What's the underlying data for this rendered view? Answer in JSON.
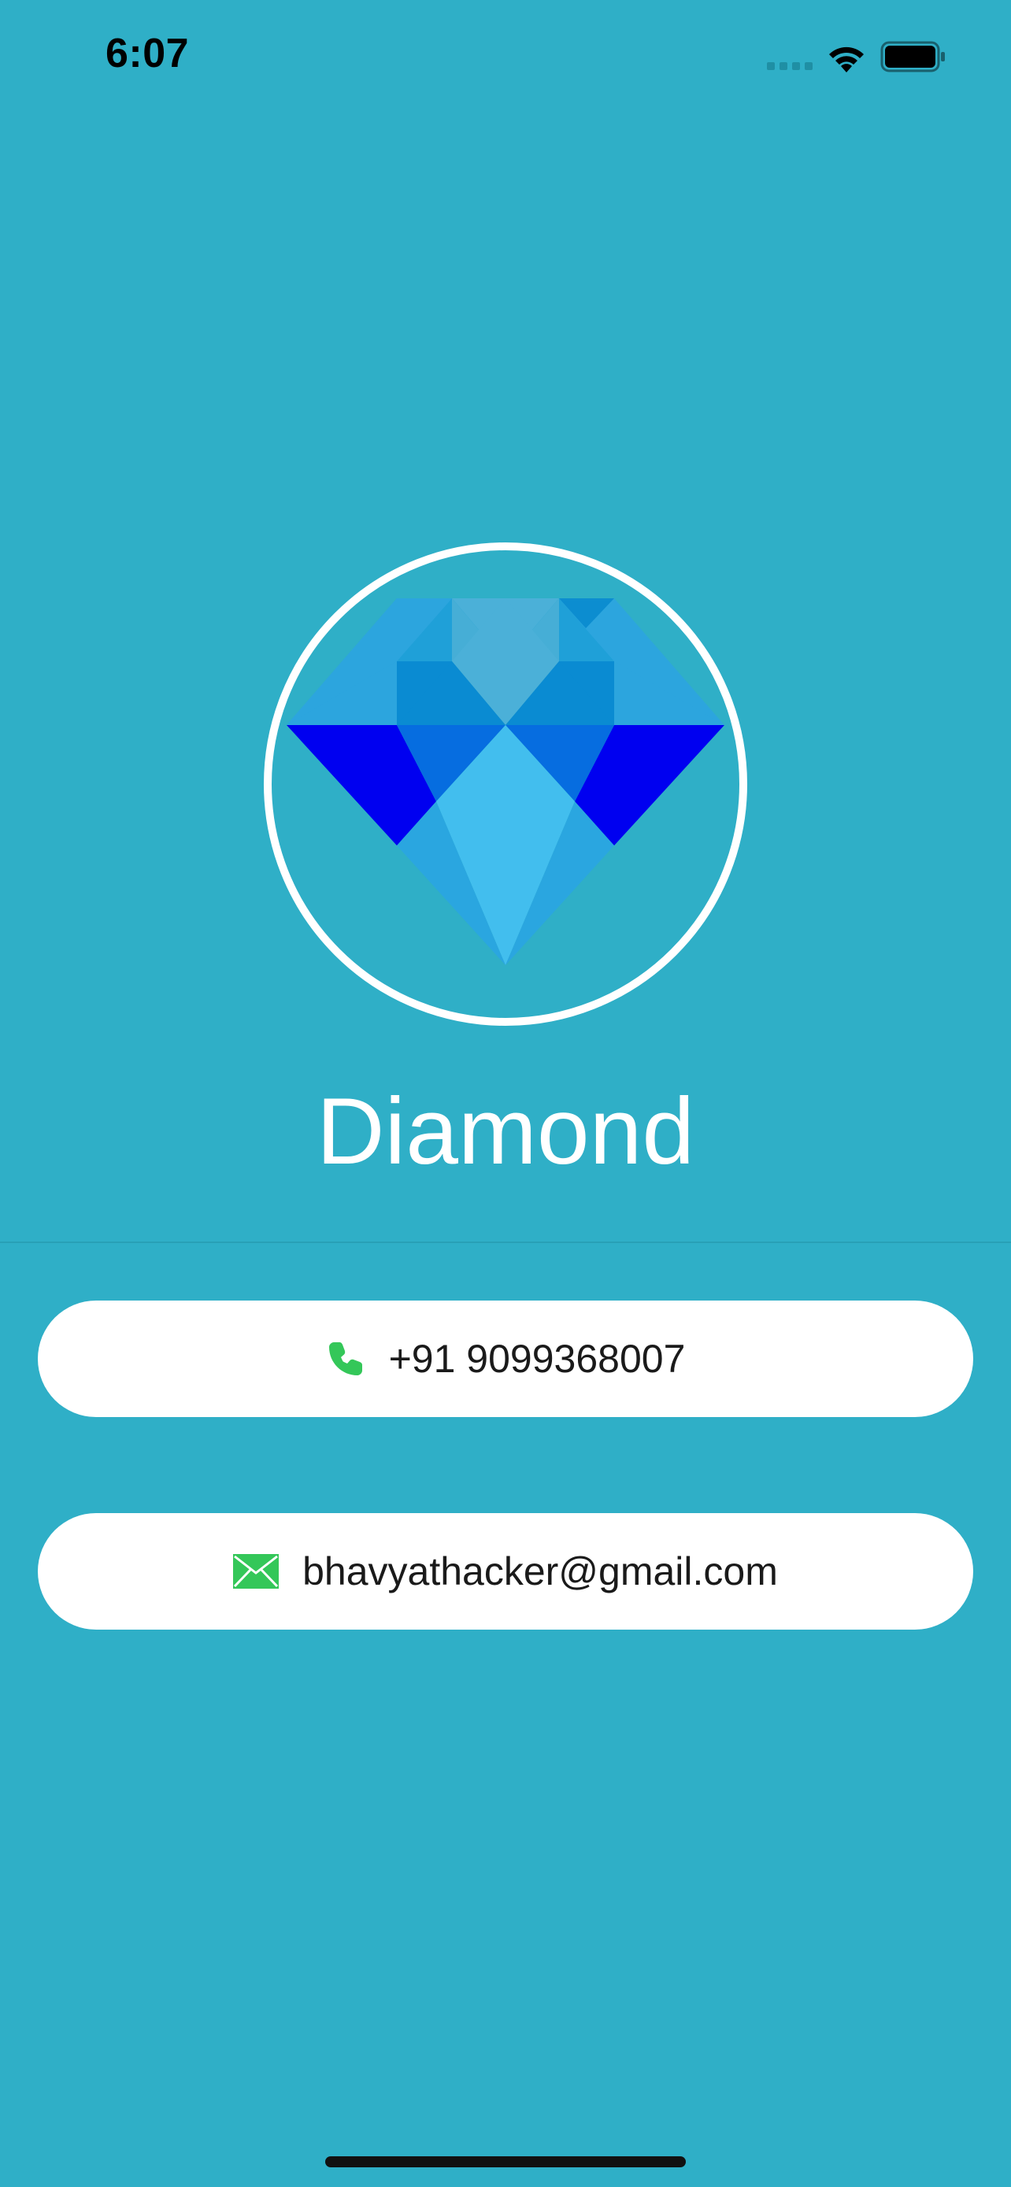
{
  "status_bar": {
    "time": "6:07",
    "icons": [
      "cellular-icon",
      "wifi-icon",
      "battery-icon"
    ]
  },
  "app": {
    "name": "Diamond",
    "logo_icon": "diamond-icon"
  },
  "contacts": {
    "phone": {
      "icon": "phone-icon",
      "value": "+91 9099368007"
    },
    "email": {
      "icon": "mail-icon",
      "value": "bhavyathacker@gmail.com"
    }
  },
  "colors": {
    "background": "#2FAFC7",
    "card": "#FFFFFF",
    "icon_green": "#34C759",
    "title": "#FFFFFF"
  }
}
